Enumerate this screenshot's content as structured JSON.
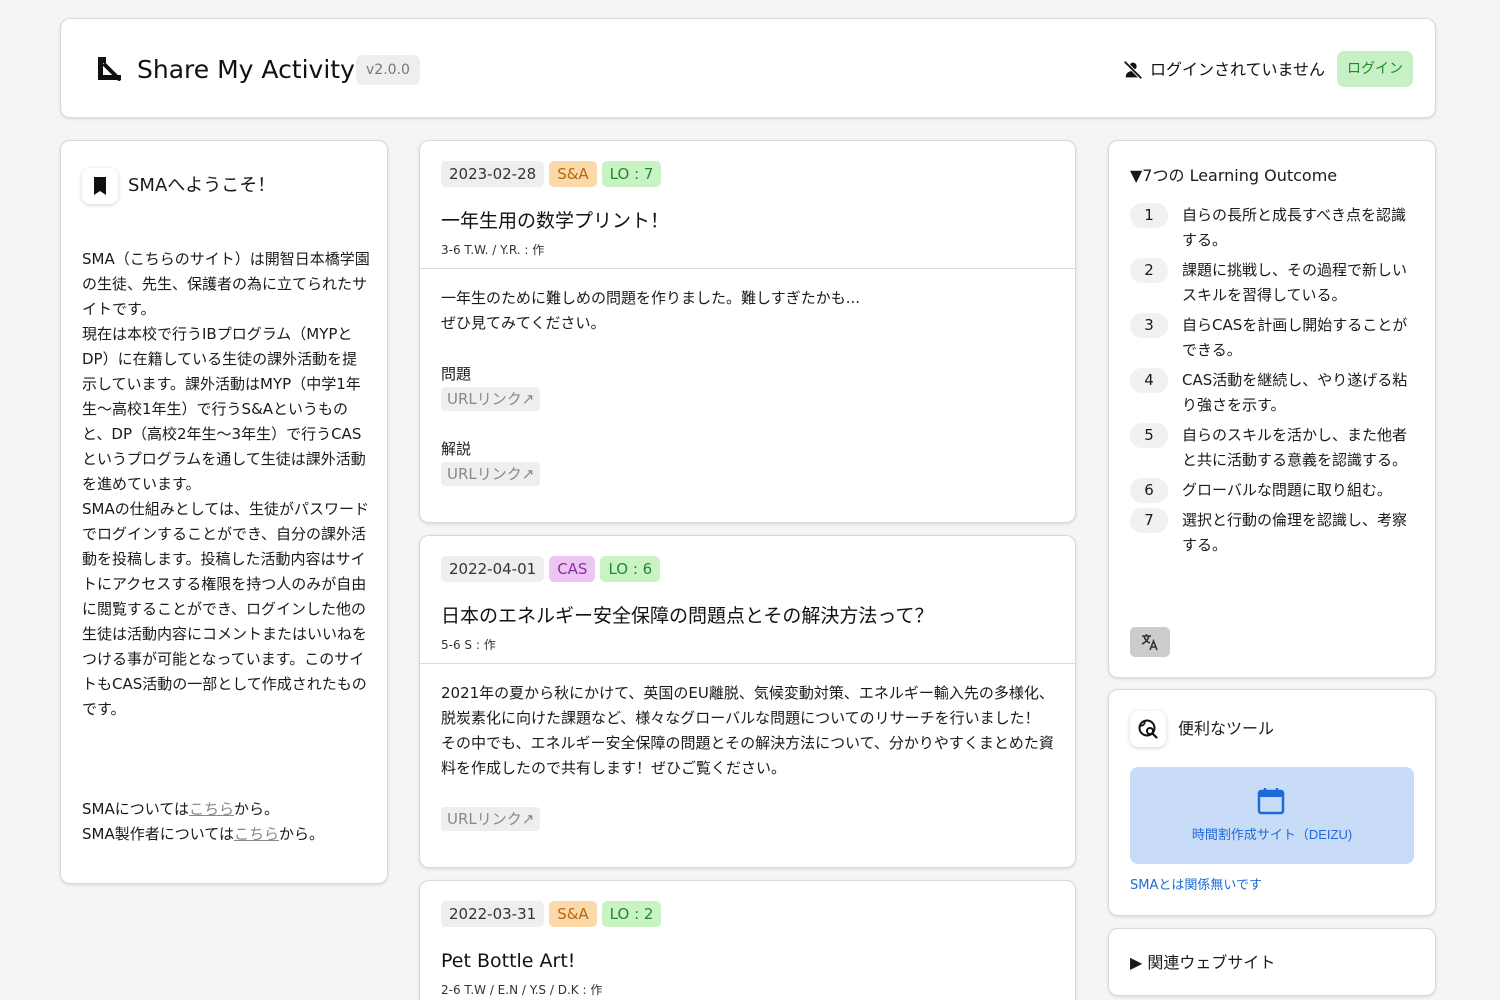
{
  "header": {
    "app_name": "Share My Activity",
    "version": "v2.0.0",
    "login_status": "ログインされていません",
    "login_button": "ログイン"
  },
  "welcome": {
    "title": "SMAへようこそ！",
    "paragraphs": [
      "SMA（こちらのサイト）は開智日本橋学園の生徒、先生、保護者の為に立てられたサイトです。",
      "現在は本校で行うIBプログラム（MYPとDP）に在籍している生徒の課外活動を提示しています。課外活動はMYP（中学1年生〜高校1年生）で行うS&Aというものと、DP（高校2年生〜3年生）で行うCASというプログラムを通して生徒は課外活動を進めています。",
      "SMAの仕組みとしては、生徒がパスワードでログインすることができ、自分の課外活動を投稿します。投稿した活動内容はサイトにアクセスする権限を持つ人のみが自由に閲覧することができ、ログインした他の生徒は活動内容にコメントまたはいいねをつける事が可能となっています。このサイトもCAS活動の一部として作成されたものです。"
    ],
    "about_sma_prefix": "SMAについては",
    "about_sma_link": "こちら",
    "about_sma_suffix": "から。",
    "about_creator_prefix": "SMA製作者については",
    "about_creator_link": "こちら",
    "about_creator_suffix": "から。"
  },
  "posts": [
    {
      "date": "2023-02-28",
      "category": "S&A",
      "lo": "LO : 7",
      "title": "一年生用の数学プリント！",
      "author": "3-6 T.W. / Y.R. : 作",
      "content_lines": [
        "一年生のために難しめの問題を作りました。難しすぎたかも...",
        "ぜひ見てみてください。"
      ],
      "sections": [
        {
          "label": "問題",
          "link": "URLリンク↗"
        },
        {
          "label": "解説",
          "link": "URLリンク↗"
        }
      ]
    },
    {
      "date": "2022-04-01",
      "category": "CAS",
      "lo": "LO : 6",
      "title": "日本のエネルギー安全保障の問題点とその解決方法って？",
      "author": "5-6 S : 作",
      "content_lines": [
        "2021年の夏から秋にかけて、英国のEU離脱、気候変動対策、エネルギー輸入先の多様化、脱炭素化に向けた課題など、様々なグローバルな問題についてのリサーチを行いました！",
        "その中でも、エネルギー安全保障の問題とその解決方法について、分かりやすくまとめた資料を作成したので共有します！ぜひご覧ください。"
      ],
      "link": "URLリンク↗"
    },
    {
      "date": "2022-03-31",
      "category": "S&A",
      "lo": "LO : 2",
      "title": "Pet Bottle Art!",
      "author": "2-6 T.W / E.N / Y.S / D.K : 作"
    }
  ],
  "learning_outcomes": {
    "title": "▼7つの Learning Outcome",
    "items": [
      {
        "num": "1",
        "text": "自らの長所と成長すべき点を認識する。"
      },
      {
        "num": "2",
        "text": "課題に挑戦し、その過程で新しいスキルを習得している。"
      },
      {
        "num": "3",
        "text": "自らCASを計画し開始することができる。"
      },
      {
        "num": "4",
        "text": "CAS活動を継続し、やり遂げる粘り強さを示す。"
      },
      {
        "num": "5",
        "text": "自らのスキルを活かし、また他者と共に活動する意義を認識する。"
      },
      {
        "num": "6",
        "text": "グローバルな問題に取り組む。"
      },
      {
        "num": "7",
        "text": "選択と行動の倫理を認識し、考察する。"
      }
    ]
  },
  "tools": {
    "title": "便利なツール",
    "button_label": "時間割作成サイト（DEIZU)",
    "note": "SMAとは関係無いです"
  },
  "related": {
    "title": "▶ 関連ウェブサイト"
  },
  "colors": {
    "sa_bg": "#fcd9a8",
    "cas_bg": "#ecc6f2",
    "lo_bg": "#c9f2c5",
    "login_bg": "#c7f0c6",
    "tool_bg": "#c8dcf8",
    "link_blue": "#1f6ad6"
  },
  "icons": {
    "logo": "sma-logo-icon",
    "login_status": "person-off-icon",
    "welcome": "bookmark-icon",
    "tools": "travel-explore-icon",
    "translate": "translate-icon",
    "tool_button": "calendar-icon"
  }
}
